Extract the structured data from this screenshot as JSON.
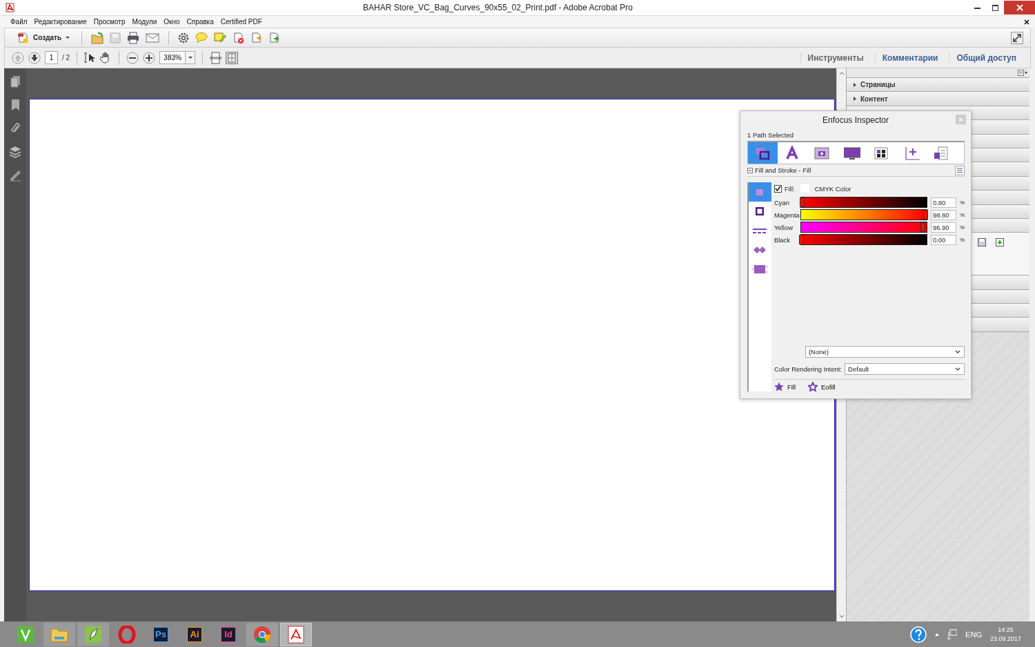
{
  "window": {
    "title": "BAHAR Store_VC_Bag_Curves_90x55_02_Print.pdf - Adobe Acrobat Pro"
  },
  "menu": [
    "Файл",
    "Редактирование",
    "Просмотр",
    "Модули",
    "Окно",
    "Справка",
    "Certified PDF"
  ],
  "toolbar": {
    "create_label": "Создать"
  },
  "nav": {
    "page": "1",
    "page_total": "/ 2",
    "zoom": "383%"
  },
  "panel_tabs": [
    {
      "label": "Инструменты",
      "disabled": true
    },
    {
      "label": "Комментарии",
      "disabled": false
    },
    {
      "label": "Общий доступ",
      "disabled": false
    }
  ],
  "right_panel": {
    "sections": [
      "Страницы",
      "Контент"
    ]
  },
  "inspector": {
    "title": "Enfocus Inspector",
    "status": "1 Path Selected",
    "tabs": [
      {
        "selected": true
      },
      {
        "selected": false
      },
      {
        "selected": false
      },
      {
        "selected": false
      },
      {
        "selected": false
      },
      {
        "selected": false
      },
      {
        "selected": false
      }
    ],
    "section_title": "Fill and Stroke - Fill",
    "side_tabs": [
      {
        "selected": true
      },
      {
        "selected": false
      },
      {
        "selected": false
      },
      {
        "selected": false
      },
      {
        "selected": false
      }
    ],
    "fill": {
      "checked": true,
      "label": "Fill:",
      "mode": "CMYK Color"
    },
    "channels": [
      {
        "name": "Cyan",
        "value": "0.80",
        "unit": "%",
        "level": 0.008
      },
      {
        "name": "Magenta",
        "value": "98.80",
        "unit": "%",
        "level": 0.988
      },
      {
        "name": "Yellow",
        "value": "96.90",
        "unit": "%",
        "level": 0.969
      },
      {
        "name": "Black",
        "value": "0.00",
        "unit": "%",
        "level": 0.0
      }
    ],
    "preset": "(None)",
    "rendering_intent": {
      "label": "Color Rendering Intent:",
      "value": "Default"
    },
    "buttons": [
      "Fill",
      "Eofill"
    ]
  },
  "taskbar": {
    "apps": [
      {
        "kind": "corel",
        "running": false,
        "selected": false
      },
      {
        "kind": "explorer",
        "running": true,
        "selected": false
      },
      {
        "kind": "corel2",
        "running": true,
        "selected": false
      },
      {
        "kind": "opera",
        "running": false,
        "selected": false
      },
      {
        "kind": "badge",
        "label": "Ps",
        "color": "#31a8ff",
        "running": false,
        "selected": false
      },
      {
        "kind": "badge",
        "label": "Ai",
        "color": "#ff9a00",
        "running": false,
        "selected": false
      },
      {
        "kind": "badge",
        "label": "Id",
        "color": "#ff3d9a",
        "running": false,
        "selected": false
      },
      {
        "kind": "chrome",
        "running": true,
        "selected": false
      },
      {
        "kind": "acrobat",
        "running": true,
        "selected": true
      }
    ],
    "language": "ENG",
    "time": "14:25",
    "date": "23.09.2017"
  }
}
